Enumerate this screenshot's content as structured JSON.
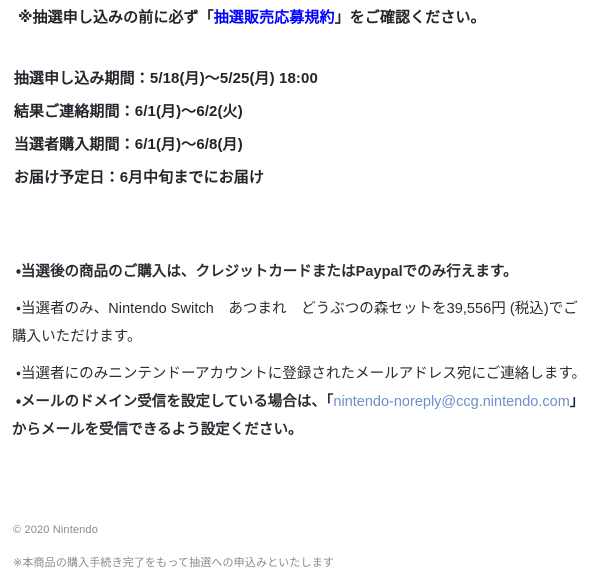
{
  "notice": {
    "prefix": "※抽選申し込みの前に必ず「",
    "link_text": "抽選販売応募規約",
    "suffix": "」をご確認ください。",
    "link_color": "#0000ff"
  },
  "schedule": {
    "rows": [
      {
        "text": "抽選申し込み期間：5/18(月)〜5/25(月) 18:00"
      },
      {
        "text": "結果ご連絡期間：6/1(月)〜6/2(火)"
      },
      {
        "text": "当選者購入期間：6/1(月)〜6/8(月)"
      },
      {
        "text": "お届け予定日：6月中旬までにお届け"
      }
    ]
  },
  "bullets": {
    "item1": "・当選後の商品のご購入は、クレジットカードまたはPaypalでのみ行えます。",
    "item2": "・当選者のみ、Nintendo Switch　あつまれ　どうぶつの森セットを39,556円 (税込)でご購入いただけます。",
    "item3": "・当選者にのみニンテンドーアカウントに登録されたメールアドレス宛にご連絡します。",
    "item4_prefix": "・メールのドメイン受信を設定している場合は、「",
    "item4_mail": "nintendo-noreply@ccg.nintendo.com",
    "item4_suffix": "」からメールを受信できるよう設定ください。",
    "mail_link_color": "#6d8fcc"
  },
  "footer": {
    "copyright": "© 2020 Nintendo",
    "note": "※本商品の購入手続き完了をもって抽選への申込みといたします",
    "text_color": "#8a8a93"
  }
}
